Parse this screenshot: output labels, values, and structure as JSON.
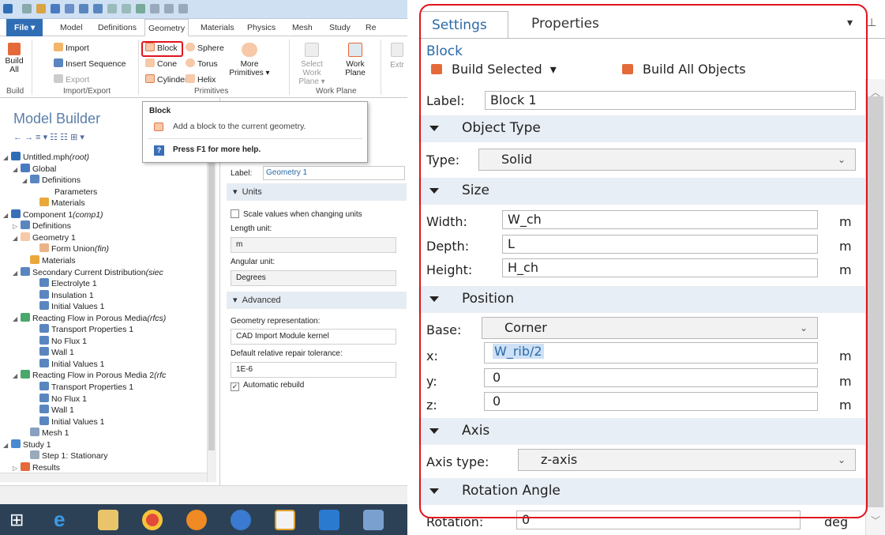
{
  "ribbon": {
    "tabs": [
      "File ▾",
      "Model",
      "Definitions",
      "Geometry",
      "Materials",
      "Physics",
      "Mesh",
      "Study",
      "Re"
    ],
    "active_tab": "Geometry",
    "build_all": "Build All",
    "import": "Import",
    "insert_sequence": "Insert Sequence",
    "export": "Export",
    "block": "Block",
    "cone": "Cone",
    "cylinder": "Cylinder",
    "sphere": "Sphere",
    "torus": "Torus",
    "helix": "Helix",
    "more_primitives": "More Primitives ▾",
    "select_work_plane": "Select Work Plane ▾",
    "work_plane": "Work Plane",
    "extr": "Extr",
    "group_build": "Build",
    "group_import_export": "Import/Export",
    "group_primitives": "Primitives",
    "group_work_plane": "Work Plane"
  },
  "tooltip": {
    "title": "Block",
    "desc": "Add a block to the current geometry.",
    "help": "Press F1 for more help."
  },
  "model_builder": {
    "title": "Model Builder",
    "tree": [
      {
        "label": "Untitled.mph",
        "tag": "(root)"
      },
      {
        "label": "Global",
        "tag": ""
      },
      {
        "label": "Definitions",
        "tag": ""
      },
      {
        "label": "Parameters",
        "tag": ""
      },
      {
        "label": "Materials",
        "tag": ""
      },
      {
        "label": "Component 1",
        "tag": "(comp1)"
      },
      {
        "label": "Definitions",
        "tag": ""
      },
      {
        "label": "Geometry 1",
        "tag": ""
      },
      {
        "label": "Form Union",
        "tag": "(fin)"
      },
      {
        "label": "Materials",
        "tag": ""
      },
      {
        "label": "Secondary Current Distribution",
        "tag": "(siec"
      },
      {
        "label": "Electrolyte 1",
        "tag": ""
      },
      {
        "label": "Insulation 1",
        "tag": ""
      },
      {
        "label": "Initial Values 1",
        "tag": ""
      },
      {
        "label": "Reacting Flow in Porous Media",
        "tag": "(rfcs)"
      },
      {
        "label": "Transport Properties 1",
        "tag": ""
      },
      {
        "label": "No Flux 1",
        "tag": ""
      },
      {
        "label": "Wall 1",
        "tag": ""
      },
      {
        "label": "Initial Values 1",
        "tag": ""
      },
      {
        "label": "Reacting Flow in Porous Media 2",
        "tag": "(rfc"
      },
      {
        "label": "Transport Properties 1",
        "tag": ""
      },
      {
        "label": "No Flux 1",
        "tag": ""
      },
      {
        "label": "Wall 1",
        "tag": ""
      },
      {
        "label": "Initial Values 1",
        "tag": ""
      },
      {
        "label": "Mesh 1",
        "tag": ""
      },
      {
        "label": "Study 1",
        "tag": ""
      },
      {
        "label": "Step 1: Stationary",
        "tag": ""
      },
      {
        "label": "Results",
        "tag": ""
      }
    ]
  },
  "geometry_settings": {
    "label_label": "Label:",
    "label_value": "Geometry 1",
    "units_header": "Units",
    "scale_values": "Scale values when changing units",
    "length_unit_label": "Length unit:",
    "length_unit_value": "m",
    "angular_unit_label": "Angular unit:",
    "angular_unit_value": "Degrees",
    "advanced_header": "Advanced",
    "geom_rep_label": "Geometry representation:",
    "geom_rep_value": "CAD Import Module kernel",
    "repair_tol_label": "Default relative repair tolerance:",
    "repair_tol_value": "1E-6",
    "auto_rebuild": "Automatic rebuild",
    "auto_rebuild_checked": true
  },
  "settings": {
    "tab_settings": "Settings",
    "tab_properties": "Properties",
    "node_title": "Block",
    "build_selected": "Build Selected",
    "build_all_objects": "Build All Objects",
    "label_label": "Label:",
    "label_value": "Block 1",
    "object_type_header": "Object Type",
    "type_label": "Type:",
    "type_value": "Solid",
    "size_header": "Size",
    "width_label": "Width:",
    "width_value": "W_ch",
    "depth_label": "Depth:",
    "depth_value": "L",
    "height_label": "Height:",
    "height_value": "H_ch",
    "unit_m": "m",
    "position_header": "Position",
    "base_label": "Base:",
    "base_value": "Corner",
    "x_label": "x:",
    "x_value": "W_rib/2",
    "y_label": "y:",
    "y_value": "0",
    "z_label": "z:",
    "z_value": "0",
    "axis_header": "Axis",
    "axis_type_label": "Axis type:",
    "axis_type_value": "z-axis",
    "rotation_header": "Rotation Angle",
    "rotation_label": "Rotation:",
    "rotation_value": "0",
    "unit_deg": "deg"
  },
  "colors": {
    "accent": "#2a6aa8",
    "highlight": "#e0141e",
    "section_bg": "#e8eef5"
  }
}
